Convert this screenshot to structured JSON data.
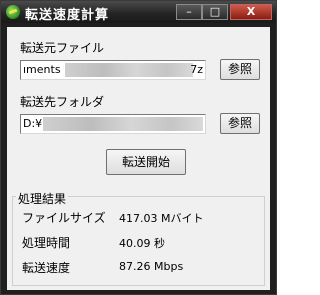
{
  "window": {
    "title": "転送速度計算"
  },
  "titlebar": {
    "minimize": "–",
    "maximize": "□",
    "close": "X"
  },
  "source": {
    "label": "転送元ファイル",
    "value_start": "ıments",
    "value_end": "7z",
    "browse": "参照"
  },
  "destination": {
    "label": "転送先フォルダ",
    "value_start": "D:¥",
    "browse": "参照"
  },
  "start_button": "転送開始",
  "results": {
    "title": "処理結果",
    "rows": [
      {
        "label": "ファイルサイズ",
        "value": "417.03 Mバイト"
      },
      {
        "label": "処理時間",
        "value": "40.09 秒"
      },
      {
        "label": "転送速度",
        "value": "87.26 Mbps"
      }
    ]
  }
}
